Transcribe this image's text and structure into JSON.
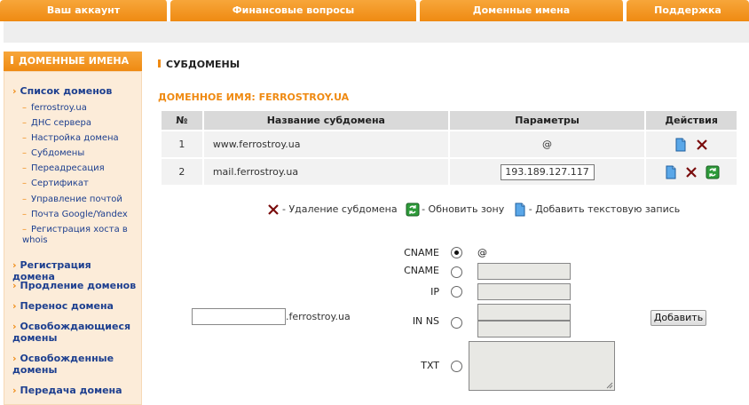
{
  "top_tabs": [
    "Ваш аккаунт",
    "Финансовые вопросы",
    "Доменные имена",
    "Поддержка"
  ],
  "sidebar": {
    "title": "ДОМЕННЫЕ ИМЕНА",
    "sections": [
      {
        "label": "Список доменов",
        "items": [
          "ferrostroy.ua",
          "ДНС сервера",
          "Настройка домена",
          "Субдомены",
          "Переадресация",
          "Сертификат",
          "Управление почтой",
          "Почта Google/Yandex",
          "Регистрация хоста в whois"
        ]
      },
      {
        "label": "Регистрация домена"
      },
      {
        "label": "Продление доменов"
      },
      {
        "label": "Перенос домена"
      },
      {
        "label": "Освобождающиеся домены"
      },
      {
        "label": "Освобожденные домены"
      },
      {
        "label": "Передача домена"
      }
    ]
  },
  "main": {
    "title": "СУБДОМЕНЫ",
    "domain_heading": "ДОМЕННОЕ ИМЯ: FERROSTROY.UA",
    "table": {
      "headers": [
        "№",
        "Название субдомена",
        "Параметры",
        "Действия"
      ],
      "rows": [
        {
          "num": "1",
          "name": "www.ferrostroy.ua",
          "param": "@"
        },
        {
          "num": "2",
          "name": "mail.ferrostroy.ua",
          "param": "193.189.127.117"
        }
      ]
    },
    "legend": {
      "delete": "- Удаление субдомена",
      "refresh": "- Обновить зону",
      "add_txt": "- Добавить текстовую запись"
    },
    "form": {
      "subdomain_value": "",
      "domain_suffix": ".ferrostroy.ua",
      "cname_at_label": "CNAME",
      "cname_at_value": "@",
      "cname_label": "CNAME",
      "ip_label": "IP",
      "inns_label": "IN NS",
      "txt_label": "TXT",
      "selected": "cname_at",
      "add_button": "Добавить"
    }
  },
  "colors": {
    "accent": "#ef8a12",
    "link": "#1d3f8f",
    "sidebar_bg": "#fcecd9"
  }
}
